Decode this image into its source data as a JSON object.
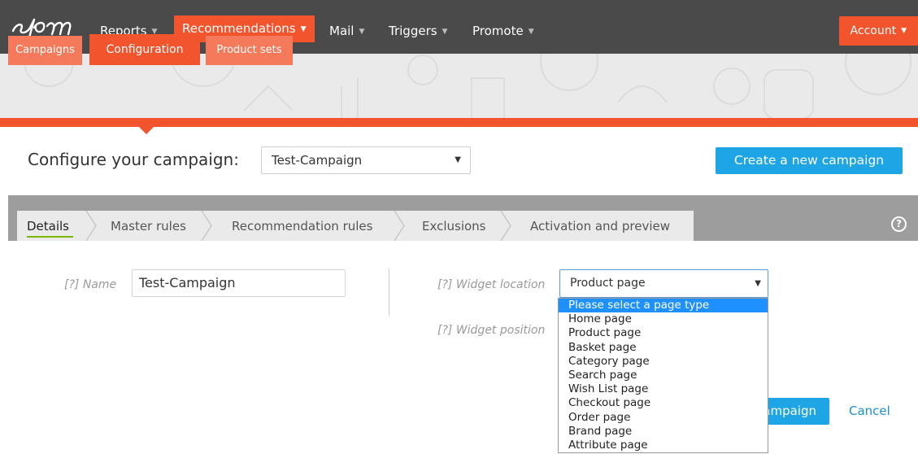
{
  "nav": {
    "items": [
      {
        "label": "Reports"
      },
      {
        "label": "Recommendations"
      },
      {
        "label": "Mail"
      },
      {
        "label": "Triggers"
      },
      {
        "label": "Promote"
      }
    ],
    "account_label": "Account"
  },
  "subtabs": [
    {
      "label": "Campaigns"
    },
    {
      "label": "Configuration"
    },
    {
      "label": "Product sets"
    }
  ],
  "config": {
    "label": "Configure your campaign:",
    "selected_campaign": "Test-Campaign",
    "create_button": "Create a new campaign"
  },
  "steps": [
    {
      "label": "Details"
    },
    {
      "label": "Master rules"
    },
    {
      "label": "Recommendation rules"
    },
    {
      "label": "Exclusions"
    },
    {
      "label": "Activation and preview"
    }
  ],
  "help_label": "?",
  "form": {
    "hint_marker": "[?]",
    "name_label": "Name",
    "name_value": "Test-Campaign",
    "widget_location_label": "Widget location",
    "widget_location_value": "Product page",
    "widget_position_label": "Widget position",
    "save_label": "ampaign",
    "cancel_label": "Cancel"
  },
  "dropdown": {
    "options": [
      "Please select a page type",
      "Home page",
      "Product page",
      "Basket page",
      "Category page",
      "Search page",
      "Wish List page",
      "Checkout page",
      "Order page",
      "Brand page",
      "Attribute page"
    ],
    "highlighted_index": 0
  },
  "colors": {
    "brand_orange": "#f2542d",
    "accent_blue": "#1ea5e6",
    "topbar": "#4a4a4a"
  }
}
